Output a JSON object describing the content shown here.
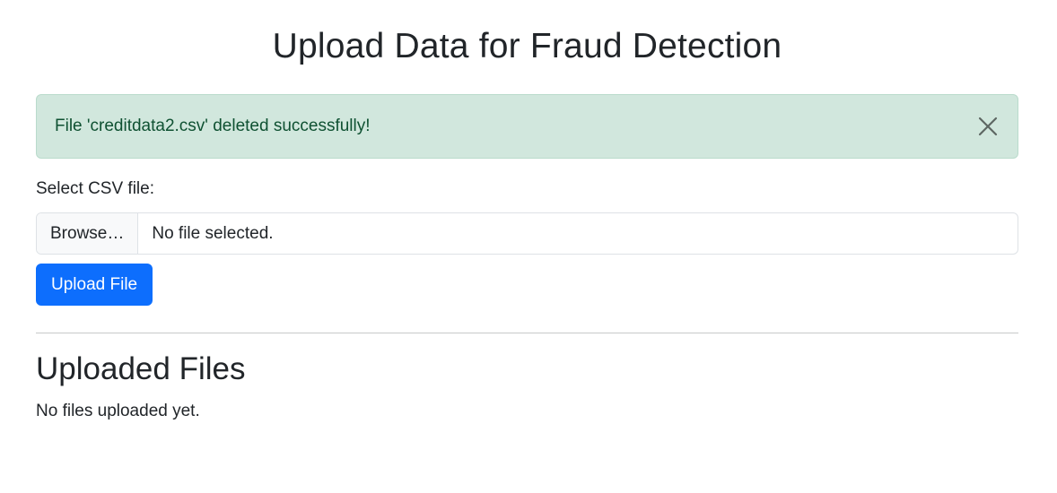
{
  "header": {
    "title": "Upload Data for Fraud Detection"
  },
  "alert": {
    "message": "File 'creditdata2.csv' deleted successfully!",
    "close_icon": "close-icon",
    "type": "success",
    "bg_color": "#d1e7dd",
    "text_color": "#0f5132"
  },
  "upload_form": {
    "label": "Select CSV file:",
    "browse_label": "Browse…",
    "file_status": "No file selected.",
    "submit_label": "Upload File",
    "submit_color": "#0d6efd"
  },
  "uploaded_files": {
    "title": "Uploaded Files",
    "empty_message": "No files uploaded yet.",
    "items": []
  }
}
